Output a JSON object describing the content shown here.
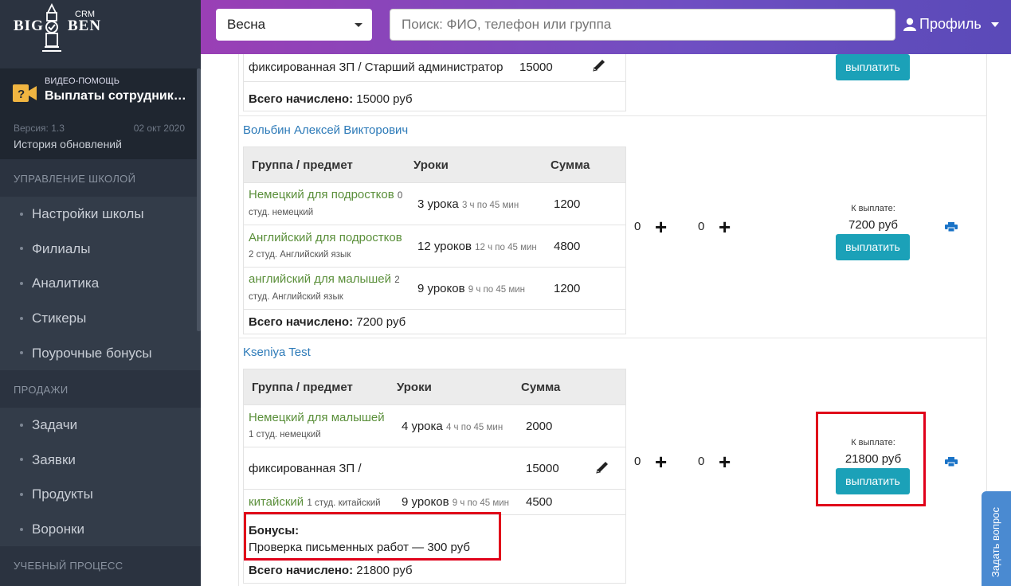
{
  "sidebar": {
    "logo": {
      "big": "BIG",
      "ben": "BEN",
      "crm": "CRM"
    },
    "video": {
      "small": "ВИДЕО-ПОМОЩЬ",
      "title": "Выплаты сотрудникам",
      "version": "Версия: 1.3",
      "date": "02 окт 2020",
      "history": "История обновлений"
    },
    "sections": [
      {
        "title": "УПРАВЛЕНИЕ ШКОЛОЙ",
        "items": [
          "Настройки школы",
          "Филиалы",
          "Аналитика",
          "Стикеры",
          "Поурочные бонусы"
        ]
      },
      {
        "title": "ПРОДАЖИ",
        "items": [
          "Задачи",
          "Заявки",
          "Продукты",
          "Воронки"
        ]
      },
      {
        "title": "УЧЕБНЫЙ ПРОЦЕСС",
        "items": []
      }
    ]
  },
  "topbar": {
    "season": "Весна",
    "search_placeholder": "Поиск: ФИО, телефон или группа",
    "profile": "Профиль"
  },
  "cards": [
    {
      "name": "",
      "rows": [
        {
          "group": "фиксированная ЗП / Старший администратор",
          "sum": "15000"
        }
      ],
      "total_label": "Всего начислено:",
      "total_value": "15000 руб",
      "pay_label": "выплатить"
    },
    {
      "name": "Вольбин Алексей Викторович",
      "headers": [
        "Группа / предмет",
        "Уроки",
        "Сумма"
      ],
      "rows": [
        {
          "group": "Немецкий для подростков",
          "count": "0",
          "sub": "студ. немецкий",
          "lessons": "3 урока",
          "hours": "3 ч по 45 мин",
          "sum": "1200"
        },
        {
          "group": "Английский для подростков",
          "count": "",
          "sub": "2 студ. Английский язык",
          "lessons": "12 уроков",
          "hours": "12 ч по 45 мин",
          "sum": "4800"
        },
        {
          "group": "английский для малышей",
          "count": "2",
          "sub": "студ. Английский язык",
          "lessons": "9 уроков",
          "hours": "9 ч по 45 мин",
          "sum": "1200"
        }
      ],
      "total_label": "Всего начислено:",
      "total_value": "7200 руб",
      "counter1": "0",
      "counter2": "0",
      "to_pay_label": "К выплате:",
      "to_pay_value": "7200 руб",
      "pay_label": "выплатить"
    },
    {
      "name": "Kseniya Test",
      "headers": [
        "Группа / предмет",
        "Уроки",
        "Сумма"
      ],
      "rows": [
        {
          "group": "Немецкий для малышей",
          "sub": "1 студ. немецкий",
          "lessons": "4 урока",
          "hours": "4 ч по 45 мин",
          "sum": "2000"
        },
        {
          "group": "фиксированная ЗП /",
          "sum": "15000"
        },
        {
          "group": "китайский",
          "sub": "1 студ. китайский",
          "lessons": "9 уроков",
          "hours": "9 ч по 45 мин",
          "sum": "4500"
        }
      ],
      "bonus_title": "Бонусы:",
      "bonus_text": "Проверка письменных работ — 300 руб",
      "total_label": "Всего начислено:",
      "total_value": "21800 руб",
      "counter1": "0",
      "counter2": "0",
      "to_pay_label": "К выплате:",
      "to_pay_value": "21800 руб",
      "pay_label": "выплатить"
    }
  ],
  "ask_question": "Задать вопрос",
  "colors": {
    "accent": "#1ba1b8",
    "link": "#2c7ab8",
    "group_green": "#5a8f3a",
    "highlight": "#e0001a"
  }
}
